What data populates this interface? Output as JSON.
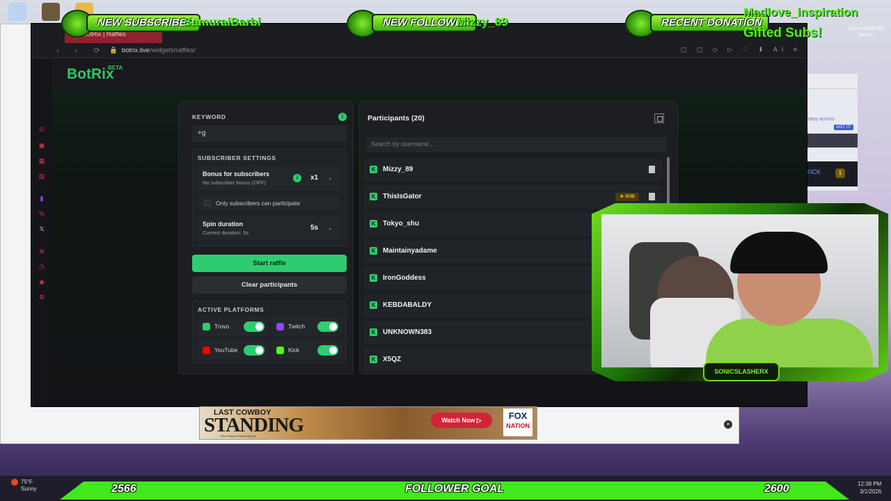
{
  "overlay": {
    "alerts": [
      {
        "label": "NEW SUBSCRIBER",
        "who": "SamuraiBarbi"
      },
      {
        "label": "NEW FOLLOWER",
        "who": "Mizzy_89"
      },
      {
        "label": "RECENT DONATION",
        "who": ""
      }
    ],
    "top_right_text": "Madlove_inspiration",
    "gifted_text": "Gifted Subs!",
    "learn_more": "Learn about this picture",
    "cam_logo": "SONICSLASHERX"
  },
  "browser": {
    "tab_title": "BotRix | Raffles",
    "url_host": "botrix.live",
    "url_path": "/widgets/raffles/",
    "toolbar_ai": "AI"
  },
  "app": {
    "logo": "BotRix",
    "beta": "BETA",
    "keyword_label": "KEYWORD",
    "keyword_value": "+g",
    "subscriber_settings_label": "SUBSCRIBER SETTINGS",
    "bonus_title": "Bonus for subscribers",
    "bonus_sub": "No subscriber bonus (OFF)",
    "bonus_value": "x1",
    "only_subs_label": "Only subscribers can participate",
    "spin_title": "Spin duration",
    "spin_sub": "Current duration: 5s",
    "spin_value": "5s",
    "start_button": "Start raffle",
    "clear_button": "Clear participants",
    "active_platforms_label": "ACTIVE PLATFORMS",
    "platforms": [
      {
        "name": "Trovo",
        "enabled": true,
        "color": "#2ecc71"
      },
      {
        "name": "Twitch",
        "enabled": true,
        "color": "#9146ff"
      },
      {
        "name": "YouTube",
        "enabled": true,
        "color": "#ff0000"
      },
      {
        "name": "Kick",
        "enabled": true,
        "color": "#53fc18"
      }
    ],
    "participants_title": "Participants (20)",
    "search_placeholder": "Search by username...",
    "participants": [
      {
        "name": "Mizzy_89",
        "badge": ""
      },
      {
        "name": "ThisIsGator",
        "badge": "SUB"
      },
      {
        "name": "Tokyo_shu",
        "badge": ""
      },
      {
        "name": "Maintainyadame",
        "badge": ""
      },
      {
        "name": "IronGoddess",
        "badge": ""
      },
      {
        "name": "KEBDABALDY",
        "badge": ""
      },
      {
        "name": "UNKNOWN383",
        "badge": ""
      },
      {
        "name": "X5QZ",
        "badge": ""
      }
    ]
  },
  "right_panel": {
    "hint": "r easy access",
    "got_it": "GOT IT!",
    "kick_text": "KICK",
    "count": "1"
  },
  "ad": {
    "line1": "LAST COWBOY",
    "line2": "STANDING",
    "tag": "New Season Streaming Now",
    "watch": "Watch Now",
    "network1": "FOX",
    "network2": "NATION"
  },
  "goal_bar": {
    "current": "2566",
    "label": "FOLLOWER GOAL",
    "target": "2600"
  },
  "taskbar": {
    "temp": "75°F",
    "weather": "Sunny",
    "time": "12:38 PM",
    "date": "3/1/2026"
  },
  "colors": {
    "accent": "#2ecc71",
    "overlay_green": "#4ef01a"
  }
}
